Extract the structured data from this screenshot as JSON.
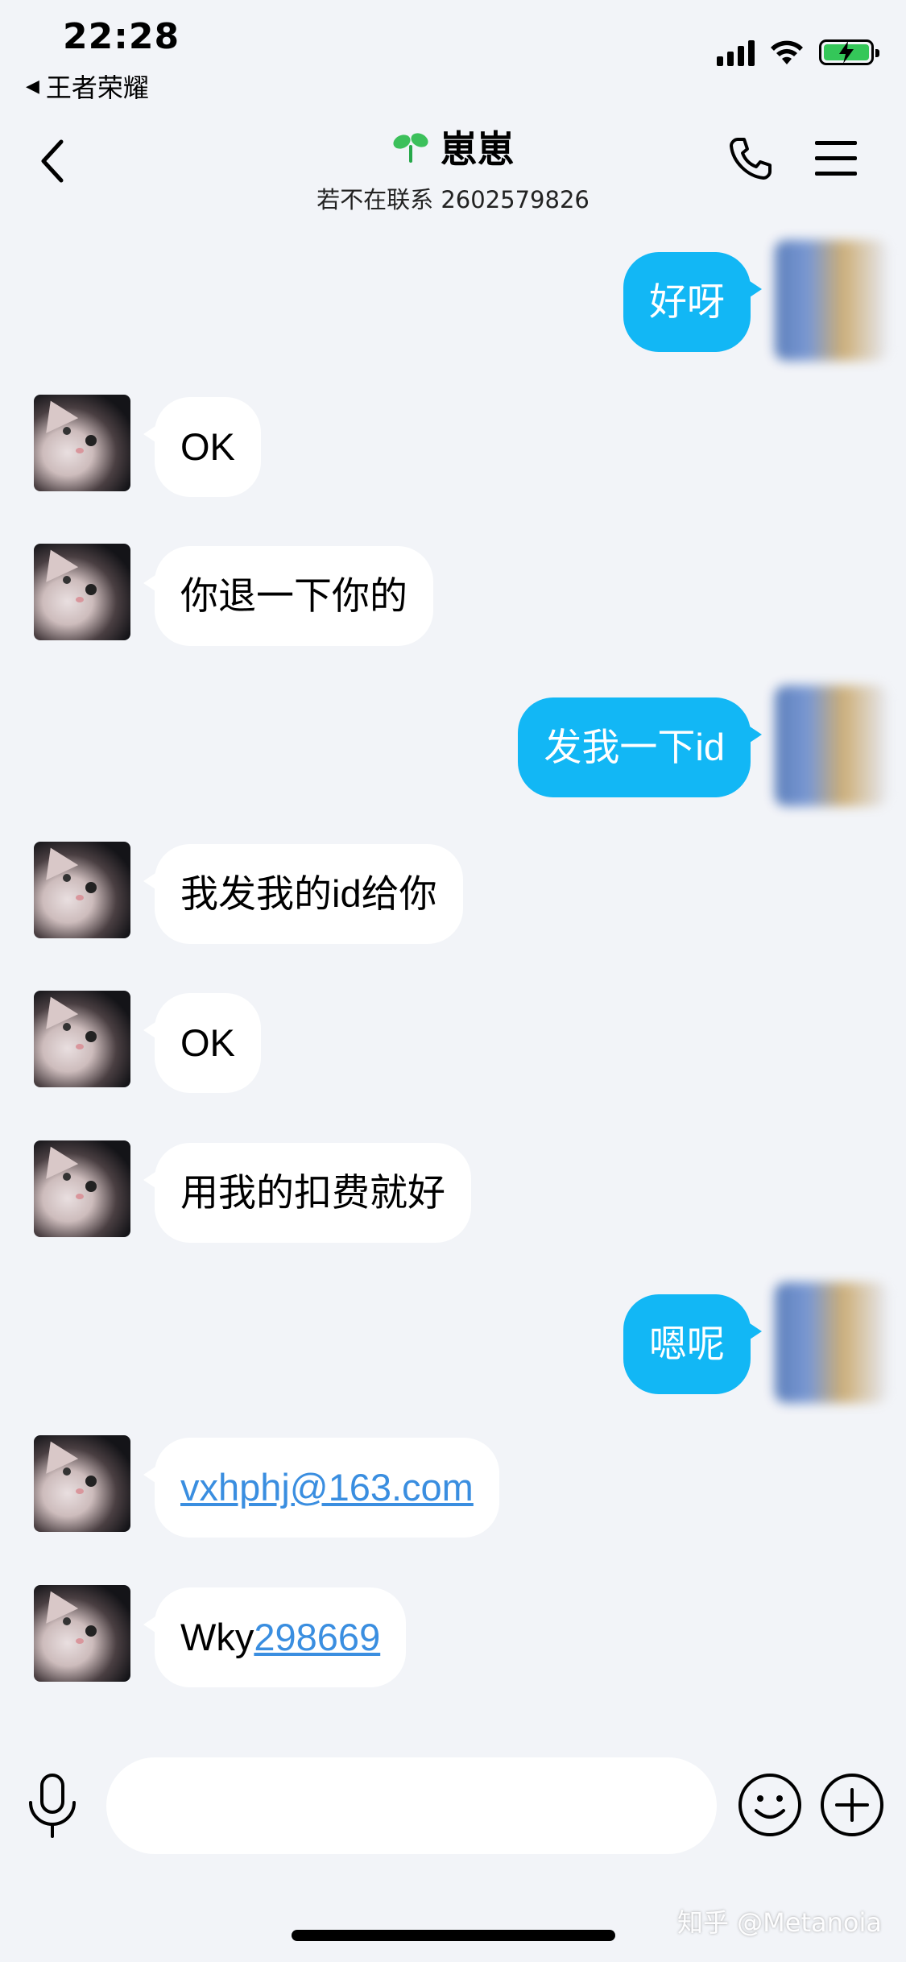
{
  "status_bar": {
    "time": "22:28",
    "back_app": "王者荣耀",
    "icons": [
      "cellular-signal-icon",
      "wifi-icon",
      "battery-charging-icon"
    ],
    "battery_color": "#34c759"
  },
  "nav": {
    "title": "崽崽",
    "subtitle": "若不在联系 2602579826",
    "icons": [
      "back-chevron-icon",
      "sprout-icon",
      "phone-icon",
      "menu-icon"
    ]
  },
  "colors": {
    "background": "#f2f4f8",
    "outgoing_bubble": "#12b7f5",
    "incoming_bubble": "#ffffff",
    "link": "#3a8ee0"
  },
  "messages": [
    {
      "side": "out",
      "text": "好呀"
    },
    {
      "side": "in",
      "text": "OK"
    },
    {
      "side": "in",
      "text": "你退一下你的"
    },
    {
      "side": "out",
      "text": "发我一下id"
    },
    {
      "side": "in",
      "text": "我发我的id给你"
    },
    {
      "side": "in",
      "text": "OK"
    },
    {
      "side": "in",
      "text": "用我的扣费就好"
    },
    {
      "side": "out",
      "text": "嗯呢"
    },
    {
      "side": "in",
      "link": "vxhphj@163.com"
    },
    {
      "side": "in",
      "prefix": "Wky",
      "link": "298669"
    }
  ],
  "input_bar": {
    "placeholder": "",
    "icons": [
      "microphone-icon",
      "emoji-icon",
      "plus-icon"
    ]
  },
  "watermark": "知乎 @Metanoia"
}
